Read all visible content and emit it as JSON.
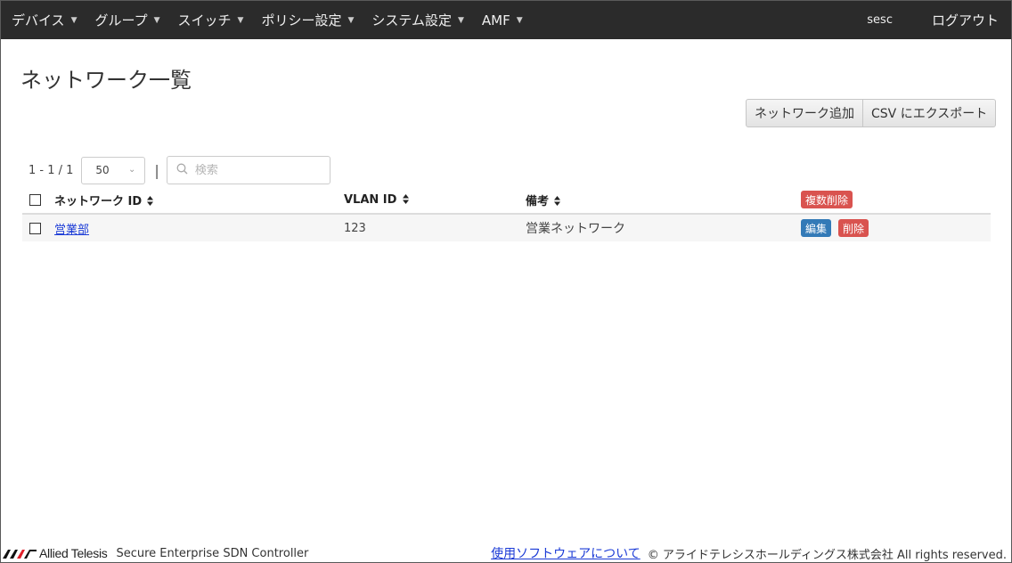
{
  "nav": {
    "items": [
      {
        "label": "デバイス"
      },
      {
        "label": "グループ"
      },
      {
        "label": "スイッチ"
      },
      {
        "label": "ポリシー設定"
      },
      {
        "label": "システム設定"
      },
      {
        "label": "AMF"
      }
    ],
    "user": "sesc",
    "logout": "ログアウト"
  },
  "page": {
    "title": "ネットワーク一覧"
  },
  "actions": {
    "add_network": "ネットワーク追加",
    "export_csv": "CSV にエクスポート"
  },
  "pager": {
    "range": "1 - 1 / 1",
    "page_size": "50",
    "separator": "|",
    "search_placeholder": "検索",
    "search_value": ""
  },
  "table": {
    "headers": {
      "network_id": "ネットワーク ID",
      "vlan_id": "VLAN ID",
      "note": "備考",
      "bulk_delete": "複数削除"
    },
    "rows": [
      {
        "network_id": "営業部",
        "vlan_id": "123",
        "note": "営業ネットワーク",
        "edit": "編集",
        "delete": "削除"
      }
    ]
  },
  "footer": {
    "logo_text": "Allied Telesis",
    "product": "Secure Enterprise SDN Controller",
    "software_link": "使用ソフトウェアについて",
    "copyright": "© アライドテレシスホールディングス株式会社 All rights reserved."
  },
  "colors": {
    "navbar": "#2b2b2b",
    "danger": "#d9534f",
    "primary": "#337ab7",
    "link": "#1a3ad6",
    "logo_red": "#e0202a"
  },
  "icons": {
    "dropdown": "caret-down-icon",
    "sort": "sort-icon",
    "search": "search-icon"
  }
}
